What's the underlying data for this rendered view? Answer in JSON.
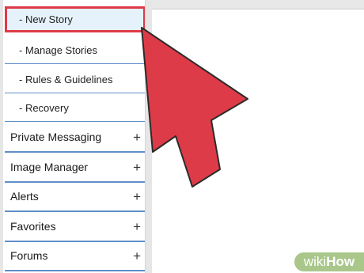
{
  "sidebar": {
    "subitems": [
      {
        "label": "- New Story"
      },
      {
        "label": "- Manage Stories"
      },
      {
        "label": "- Rules & Guidelines"
      },
      {
        "label": "- Recovery"
      }
    ],
    "sections": [
      {
        "label": "Private Messaging",
        "toggle": "+"
      },
      {
        "label": "Image Manager",
        "toggle": "+"
      },
      {
        "label": "Alerts",
        "toggle": "+"
      },
      {
        "label": "Favorites",
        "toggle": "+"
      },
      {
        "label": "Forums",
        "toggle": "+"
      }
    ]
  },
  "watermark": {
    "prefix": "wiki",
    "brand": "How"
  },
  "colors": {
    "arrow": "#de3b48",
    "divider": "#5f8fc9",
    "active_bg": "#e6f2fb",
    "watermark_bg": "#a9c78b"
  }
}
